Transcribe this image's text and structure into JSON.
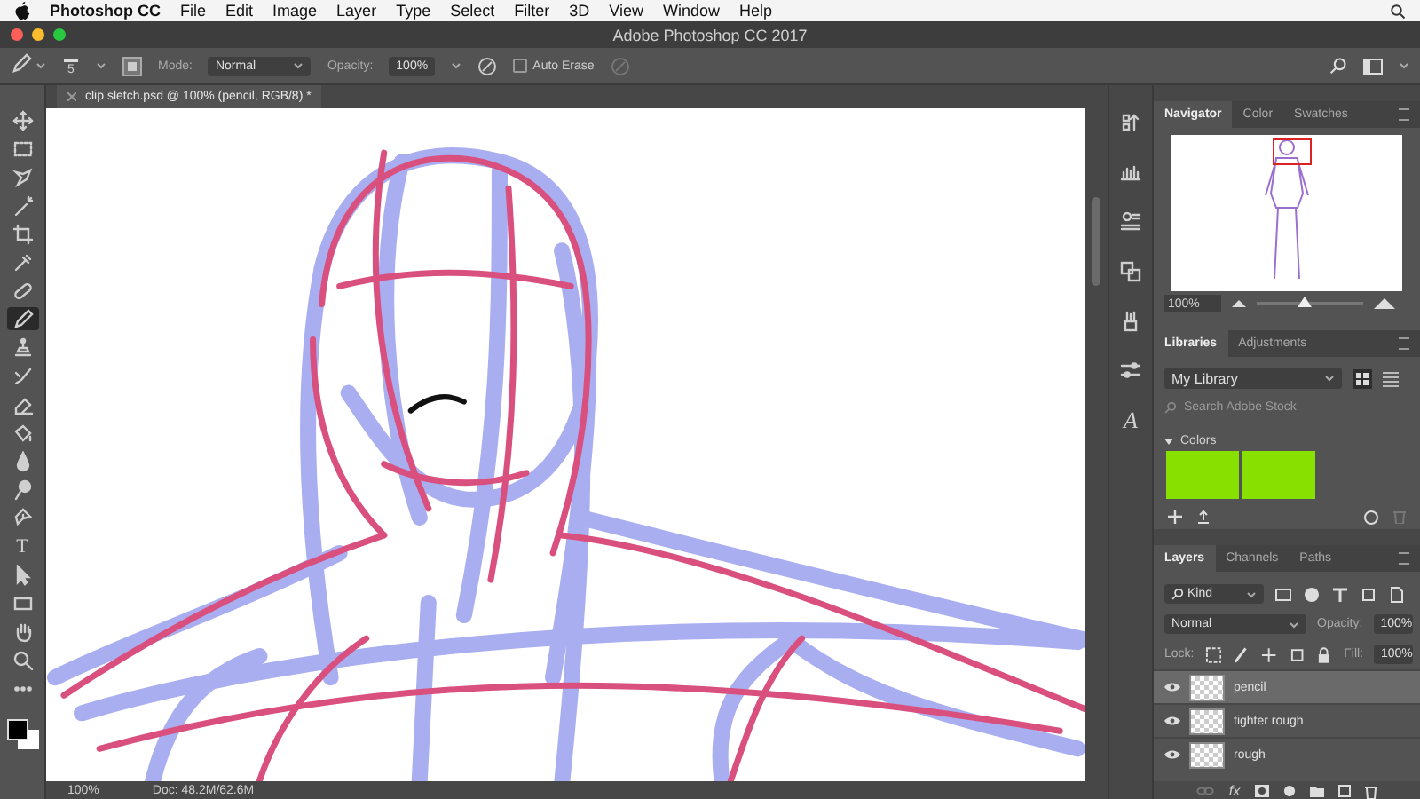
{
  "menu_bar": {
    "app_name": "Photoshop CC",
    "items": [
      "File",
      "Edit",
      "Image",
      "Layer",
      "Type",
      "Select",
      "Filter",
      "3D",
      "View",
      "Window",
      "Help"
    ]
  },
  "window": {
    "title": "Adobe Photoshop CC 2017"
  },
  "options_bar": {
    "brush_size": "5",
    "mode_label": "Mode:",
    "mode": "Normal",
    "opacity_label": "Opacity:",
    "opacity": "100%",
    "auto_erase": {
      "label": "Auto Erase",
      "checked": false
    }
  },
  "document": {
    "tab_title": "clip sletch.psd @ 100% (pencil, RGB/8) *"
  },
  "tools": [
    {
      "kind": "move",
      "selected": false
    },
    {
      "kind": "marquee",
      "selected": false
    },
    {
      "kind": "lasso",
      "selected": false
    },
    {
      "kind": "wand",
      "selected": false
    },
    {
      "kind": "crop",
      "selected": false
    },
    {
      "kind": "eyedropper",
      "selected": false
    },
    {
      "kind": "healing",
      "selected": false
    },
    {
      "kind": "pencil",
      "selected": true
    },
    {
      "kind": "stamp",
      "selected": false
    },
    {
      "kind": "history-brush",
      "selected": false
    },
    {
      "kind": "eraser",
      "selected": false
    },
    {
      "kind": "bucket",
      "selected": false
    },
    {
      "kind": "blur",
      "selected": false
    },
    {
      "kind": "dodge",
      "selected": false
    },
    {
      "kind": "pen",
      "selected": false
    },
    {
      "kind": "type",
      "label": "T",
      "selected": false
    },
    {
      "kind": "path-select",
      "selected": false
    },
    {
      "kind": "rectangle",
      "selected": false
    },
    {
      "kind": "hand",
      "selected": false
    },
    {
      "kind": "zoom",
      "selected": false
    },
    {
      "kind": "more",
      "selected": false
    }
  ],
  "status_bar": {
    "zoom": "100%",
    "doc_info": "Doc: 48.2M/62.6M"
  },
  "dock": [
    {
      "kind": "history"
    },
    {
      "kind": "histogram"
    },
    {
      "kind": "properties"
    },
    {
      "kind": "clone-source"
    },
    {
      "kind": "brush-presets"
    },
    {
      "kind": "sliders"
    },
    {
      "kind": "character",
      "label": "A"
    }
  ],
  "navigator_panel": {
    "tabs": [
      {
        "label": "Navigator",
        "selected": true
      },
      {
        "label": "Color",
        "selected": false
      },
      {
        "label": "Swatches",
        "selected": false
      }
    ],
    "zoom": "100%",
    "zoom_slider": {
      "level": 0.45
    }
  },
  "libraries_panel": {
    "tabs": [
      {
        "label": "Libraries",
        "selected": true
      },
      {
        "label": "Adjustments",
        "selected": false
      }
    ],
    "library": "My Library",
    "search": {
      "placeholder": "Search Adobe Stock"
    },
    "section": {
      "title": "Colors",
      "expanded": true
    },
    "swatches": [
      {
        "color": "#88e000"
      },
      {
        "color": "#88e000"
      }
    ]
  },
  "layers_panel": {
    "tabs": [
      {
        "label": "Layers",
        "selected": true
      },
      {
        "label": "Channels",
        "selected": false
      },
      {
        "label": "Paths",
        "selected": false
      }
    ],
    "filter": "Kind",
    "blend_mode": "Normal",
    "opacity_label": "Opacity:",
    "opacity": "100%",
    "lock_label": "Lock:",
    "fill_label": "Fill:",
    "fill": "100%",
    "footer_effects_label": "fx",
    "layers": [
      {
        "name": "pencil",
        "visible": true,
        "selected": true
      },
      {
        "name": "tighter rough",
        "visible": true,
        "selected": false
      },
      {
        "name": "rough",
        "visible": true,
        "selected": false
      }
    ]
  }
}
